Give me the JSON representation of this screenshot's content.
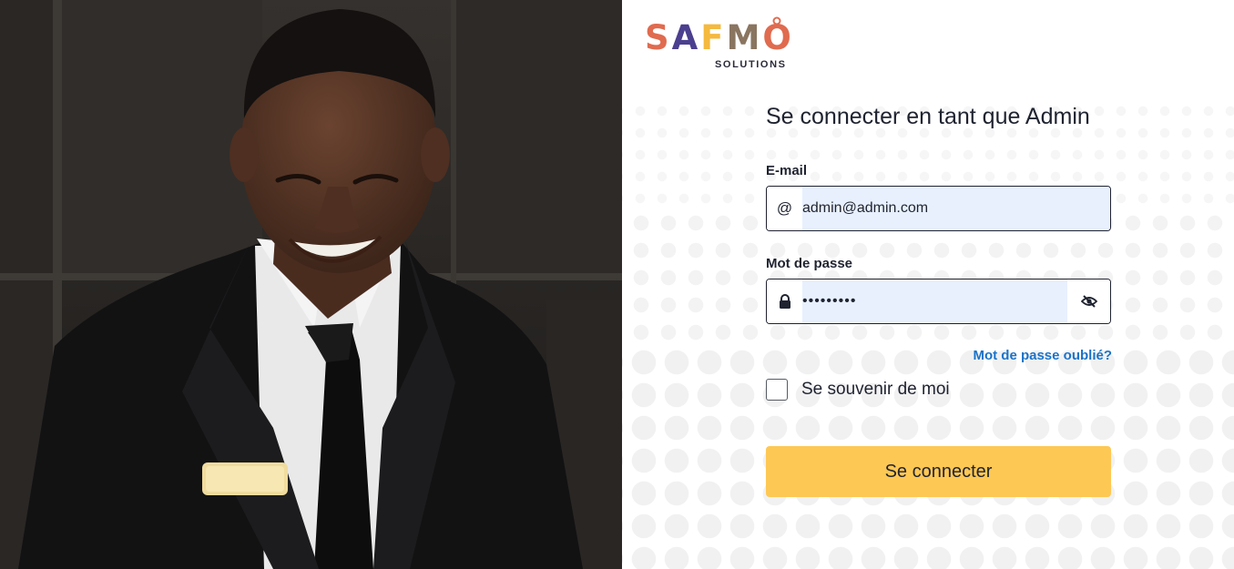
{
  "logo": {
    "letters": [
      "S",
      "A",
      "F",
      "M",
      "O"
    ],
    "subtitle": "SOLUTIONS",
    "colors": {
      "coral": "#e06b4f",
      "indigo": "#4b3f8f",
      "yellow": "#f4b93f",
      "brown": "#8a7560"
    }
  },
  "login": {
    "title": "Se connecter en tant que Admin",
    "email_label": "E-mail",
    "email_value": "admin@admin.com",
    "email_icon": "at-icon",
    "password_label": "Mot de passe",
    "password_value": "•••••••••",
    "password_icon": "lock-icon",
    "toggle_icon": "eye-slash-icon",
    "forgot_link": "Mot de passe oublié?",
    "remember_label": "Se souvenir de moi",
    "submit_label": "Se connecter"
  },
  "colors": {
    "accent": "#fdc854",
    "link": "#1a73c9",
    "autofill_bg": "#e8f0fe"
  }
}
